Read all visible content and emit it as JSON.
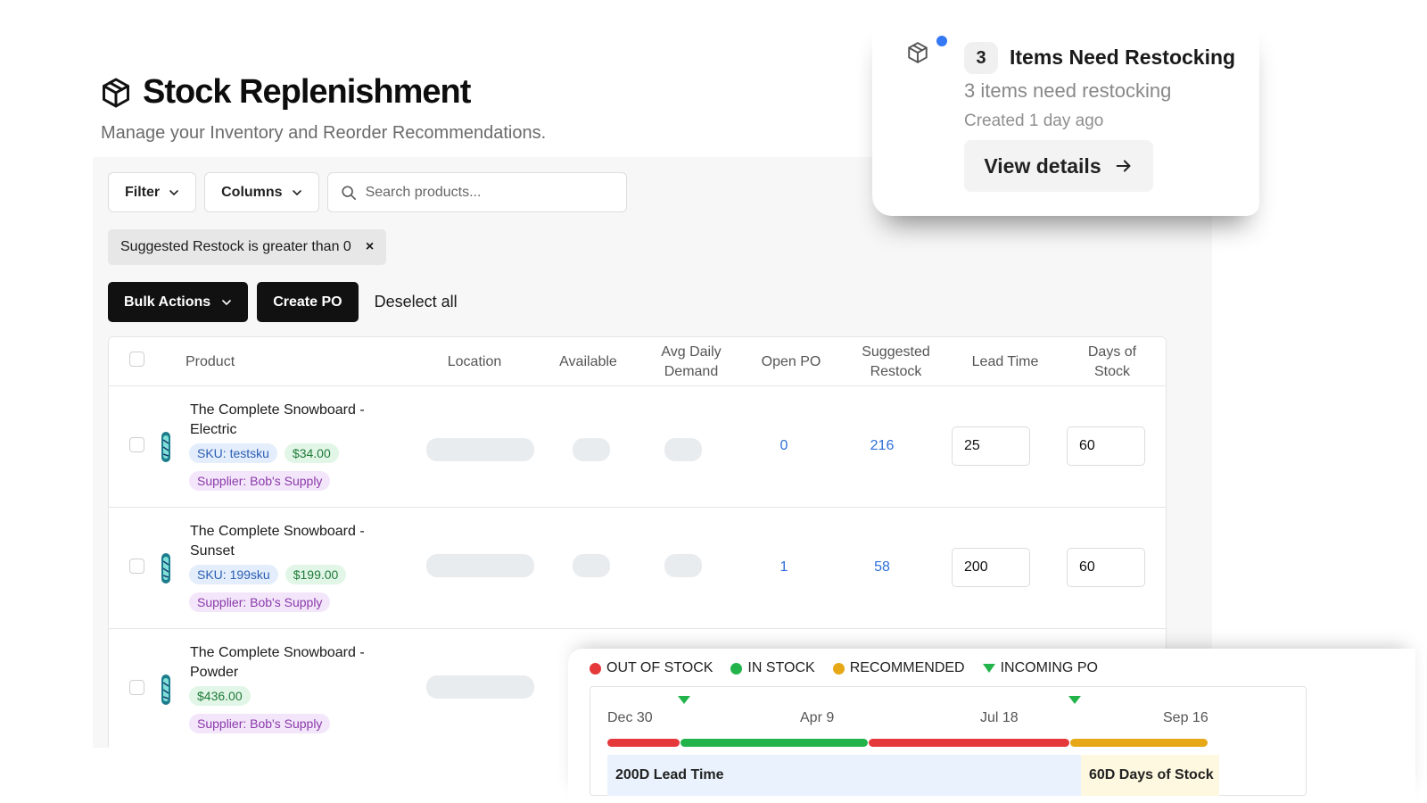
{
  "header": {
    "title": "Stock Replenishment",
    "subtitle": "Manage your Inventory and Reorder Recommendations."
  },
  "toolbar": {
    "filter_label": "Filter",
    "columns_label": "Columns",
    "search_placeholder": "Search products..."
  },
  "active_filter": {
    "label": "Suggested Restock is greater than 0",
    "remove": "×"
  },
  "actions": {
    "bulk_label": "Bulk Actions",
    "create_po_label": "Create PO",
    "deselect_label": "Deselect all"
  },
  "table": {
    "columns": {
      "product": "Product",
      "location": "Location",
      "available": "Available",
      "avg_daily_demand": "Avg Daily Demand",
      "open_po": "Open PO",
      "suggested_restock": "Suggested Restock",
      "lead_time": "Lead Time",
      "days_of_stock": "Days of Stock"
    },
    "rows": [
      {
        "name": "The Complete Snowboard - Electric",
        "sku": "SKU: testsku",
        "price": "$34.00",
        "supplier": "Supplier: Bob's Supply",
        "open_po": "0",
        "suggested_restock": "216",
        "lead_time": "25",
        "days_of_stock": "60"
      },
      {
        "name": "The Complete Snowboard - Sunset",
        "sku": "SKU: 199sku",
        "price": "$199.00",
        "supplier": "Supplier: Bob's Supply",
        "open_po": "1",
        "suggested_restock": "58",
        "lead_time": "200",
        "days_of_stock": "60"
      },
      {
        "name": "The Complete Snowboard - Powder",
        "price": "$436.00",
        "supplier": "Supplier: Bob's Supply"
      }
    ]
  },
  "notification": {
    "count": "3",
    "title": "Items Need Restocking",
    "description": "3 items need restocking",
    "time": "Created 1 day ago",
    "button_label": "View details",
    "dot_color": "#3478f6"
  },
  "timeline": {
    "legend": [
      {
        "label": "OUT OF STOCK",
        "color": "#e5383b"
      },
      {
        "label": "IN STOCK",
        "color": "#22b44a"
      },
      {
        "label": "RECOMMENDED",
        "color": "#e6a817"
      },
      {
        "label": "INCOMING PO",
        "color": "#22b44a"
      }
    ],
    "dates": [
      "Dec 30",
      "Apr 9",
      "Jul 18",
      "Sep 16"
    ],
    "lead_time_label": "200D Lead Time",
    "days_of_stock_label": "60D Days of Stock"
  }
}
